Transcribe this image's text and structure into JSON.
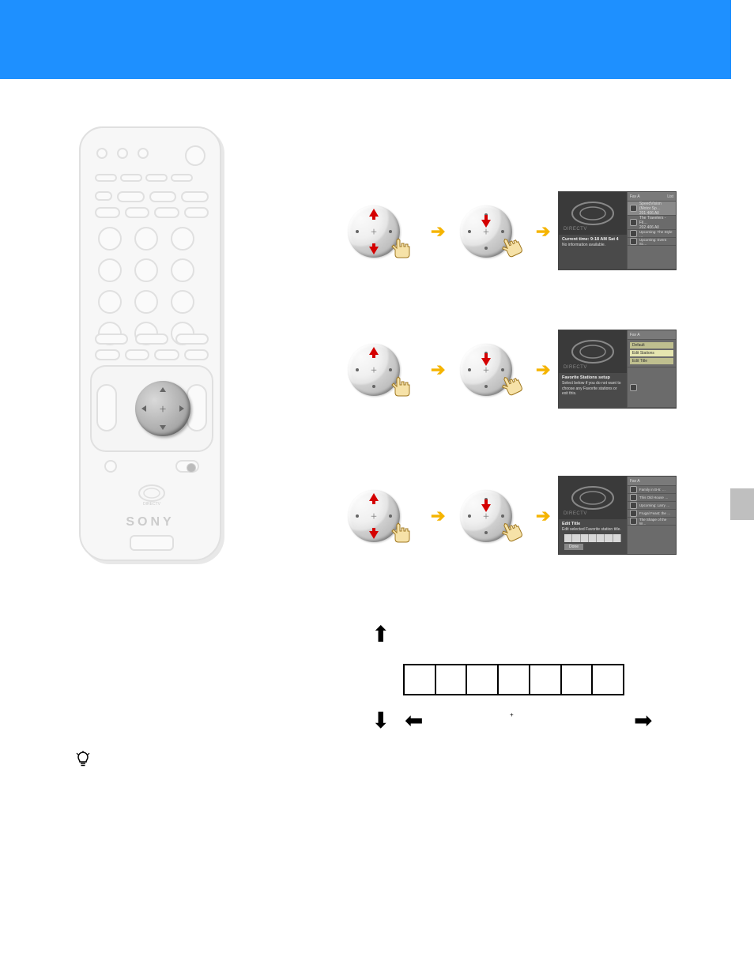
{
  "banner": {
    "color": "#1E90FF"
  },
  "remote": {
    "brand": "SONY",
    "logo": "DIRECTV"
  },
  "step1": {
    "screen": {
      "preview_logo": "DIRECTV",
      "info_title": "Current time: 9:18 AM Sat 4",
      "info_line": "No information available.",
      "rc_head_left": "Fav A",
      "rc_head_right": "List",
      "items": [
        {
          "title": "SpeedVision (Motor Sp…",
          "sub": "201   406   All"
        },
        {
          "title": "The Travelers - Fil…",
          "sub": "202   406   All"
        },
        {
          "title": "Upcoming: The Style …"
        },
        {
          "title": "Upcoming: Event Sc…"
        }
      ]
    }
  },
  "step2": {
    "screen": {
      "preview_logo": "DIRECTV",
      "favtitle": "Favorite Stations setup",
      "favtext": "Select below if you do not want to choose any Favorite stations or exit this.",
      "buttons": {
        "default": "Default",
        "edit": "Edit Stations",
        "title": "Edit Title"
      },
      "rc_head_left": "Fav A"
    }
  },
  "step3": {
    "screen": {
      "preview_logo": "DIRECTV",
      "edittitle": "Edit Title",
      "edittext": "Edit selected Favorite station title.",
      "done": "Done",
      "rc_head_left": "Fav A",
      "items": [
        {
          "title": "Family in B-6: …"
        },
        {
          "title": "This Old House …"
        },
        {
          "title": "Upcoming: Larry …"
        },
        {
          "title": "Frugal Feast: the …"
        },
        {
          "title": "The Shape of the W…"
        }
      ]
    }
  },
  "diagram": {
    "center_symbol": "+"
  }
}
